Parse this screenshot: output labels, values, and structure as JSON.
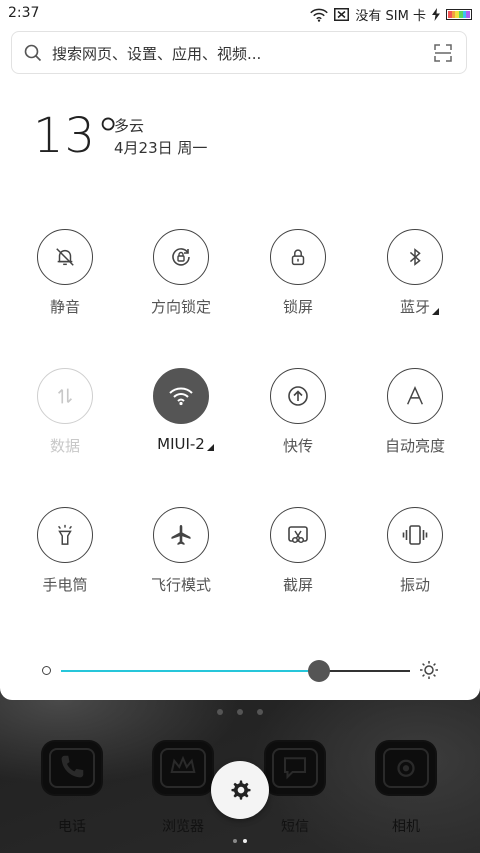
{
  "statusbar": {
    "time": "2:37",
    "sim_text": "没有 SIM 卡"
  },
  "search": {
    "placeholder": "搜索网页、设置、应用、视频..."
  },
  "weather": {
    "temperature": "13°",
    "condition": "多云",
    "date": "4月23日 周一"
  },
  "toggles": [
    {
      "label": "静音",
      "icon": "bell-off-icon",
      "state": "off"
    },
    {
      "label": "方向锁定",
      "icon": "rotation-lock-icon",
      "state": "off"
    },
    {
      "label": "锁屏",
      "icon": "lock-icon",
      "state": "off"
    },
    {
      "label": "蓝牙",
      "icon": "bluetooth-icon",
      "state": "off"
    },
    {
      "label": "数据",
      "icon": "mobile-data-icon",
      "state": "disabled"
    },
    {
      "label": "MIUI-2",
      "icon": "wifi-icon",
      "state": "on"
    },
    {
      "label": "快传",
      "icon": "quick-share-icon",
      "state": "off"
    },
    {
      "label": "自动亮度",
      "icon": "auto-brightness-icon",
      "state": "off"
    },
    {
      "label": "手电筒",
      "icon": "flashlight-icon",
      "state": "off"
    },
    {
      "label": "飞行模式",
      "icon": "airplane-icon",
      "state": "off"
    },
    {
      "label": "截屏",
      "icon": "screenshot-icon",
      "state": "off"
    },
    {
      "label": "振动",
      "icon": "vibrate-icon",
      "state": "off"
    }
  ],
  "brightness": {
    "level": 0.74,
    "accent": "#26c6da"
  },
  "dock": {
    "apps": [
      {
        "label": "电话",
        "icon": "phone-icon"
      },
      {
        "label": "浏览器",
        "icon": "browser-icon"
      },
      {
        "label": "短信",
        "icon": "messages-icon"
      },
      {
        "label": "相机",
        "icon": "camera-icon"
      }
    ]
  },
  "colors": {
    "panel_bg": "#ffffff",
    "active_toggle": "#555555",
    "icon_stroke": "#444444",
    "disabled": "#c8c8c8"
  }
}
